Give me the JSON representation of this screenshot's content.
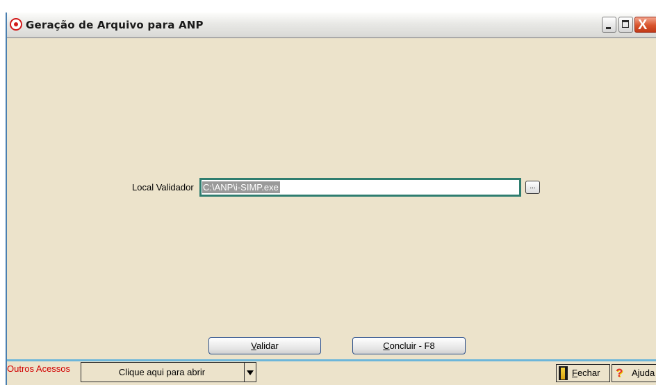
{
  "window": {
    "title": "Geração de Arquivo para ANP",
    "close_glyph": "X",
    "icons": {
      "app": "app-target-icon",
      "minimize": "minimize-icon",
      "maximize": "maximize-icon",
      "close": "close-icon"
    }
  },
  "form": {
    "local_validador_label": "Local Validador",
    "local_validador_value": "C:\\ANP\\i-SIMP.exe",
    "browse_label": "..."
  },
  "buttons": {
    "validar_accel": "V",
    "validar_rest": "alidar",
    "concluir_accel": "C",
    "concluir_rest": "oncluir - F8"
  },
  "footer": {
    "outros_acessos_label": "Outros Acessos",
    "dropdown_value": "Clique aqui para abrir",
    "fechar_accel": "F",
    "fechar_rest": "echar",
    "ajuda_label": "Ajuda",
    "help_glyph": "?"
  },
  "colors": {
    "window_bg": "#ece3cb",
    "input_border": "#2f7d6f",
    "divider": "#6cb6da",
    "outros_text": "#d10000",
    "close_button": "#d8542d"
  }
}
